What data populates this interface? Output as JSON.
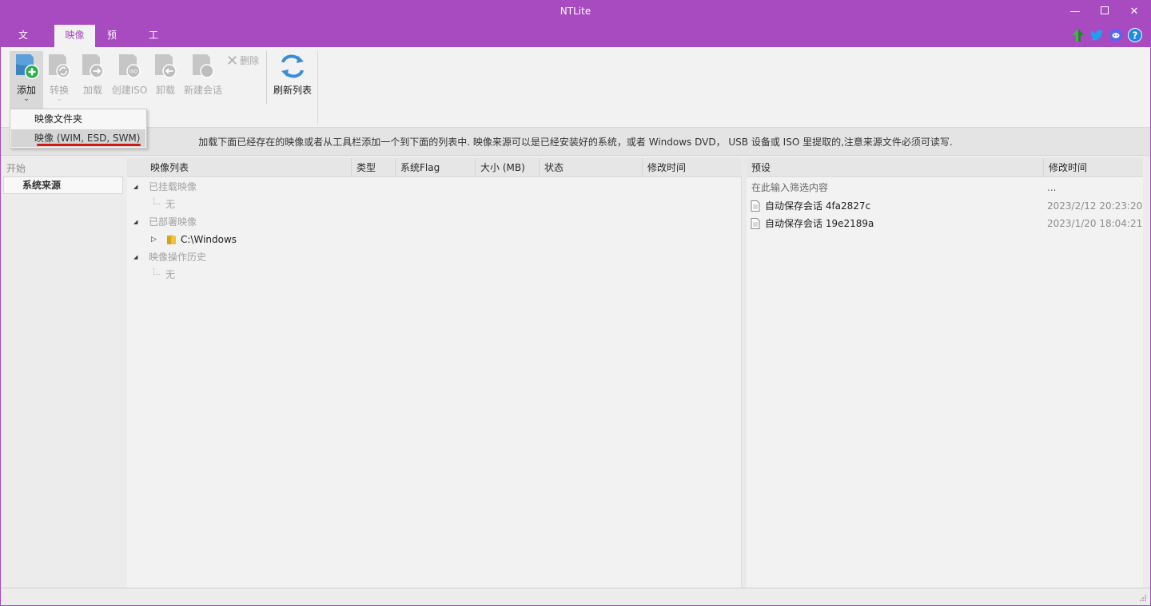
{
  "window": {
    "title": "NTLite"
  },
  "menu": {
    "items": [
      "文件",
      "映像",
      "预设",
      "工具"
    ],
    "active": "映像"
  },
  "ribbon": {
    "add": "添加",
    "convert": "转换",
    "load": "加载",
    "create_iso": "创建ISO",
    "unload": "卸载",
    "new_session": "新建会话",
    "delete": "删除",
    "refresh": "刷新列表"
  },
  "dropdown": {
    "item1": "映像文件夹",
    "item2": "映像 (WIM, ESD, SWM)"
  },
  "info": {
    "text": "加载下面已经存在的映像或者从工具栏添加一个到下面的列表中. 映像来源可以是已经安装好的系统，或者 Windows DVD， USB 设备或 ISO 里提取的,注意来源文件必须可读写."
  },
  "sidebar": {
    "heading": "开始",
    "item": "系统来源"
  },
  "list": {
    "columns": [
      "映像列表",
      "类型",
      "系统Flag",
      "大小 (MB)",
      "状态",
      "修改时间"
    ],
    "groups": {
      "mounted": "已挂载映像",
      "mounted_child": "无",
      "deployed": "已部署映像",
      "deployed_child": "C:\\Windows",
      "history": "映像操作历史",
      "history_child": "无"
    }
  },
  "presets": {
    "columns": [
      "预设",
      "修改时间"
    ],
    "filter_placeholder": "在此输入筛选内容",
    "filter_dots": "...",
    "rows": [
      {
        "name": "自动保存会话 4fa2827c",
        "date": "2023/2/12 20:23:20"
      },
      {
        "name": "自动保存会话 19e2189a",
        "date": "2023/1/20 18:04:21"
      }
    ]
  },
  "colors": {
    "accent": "#a84ac0",
    "underline": "#d41818"
  }
}
